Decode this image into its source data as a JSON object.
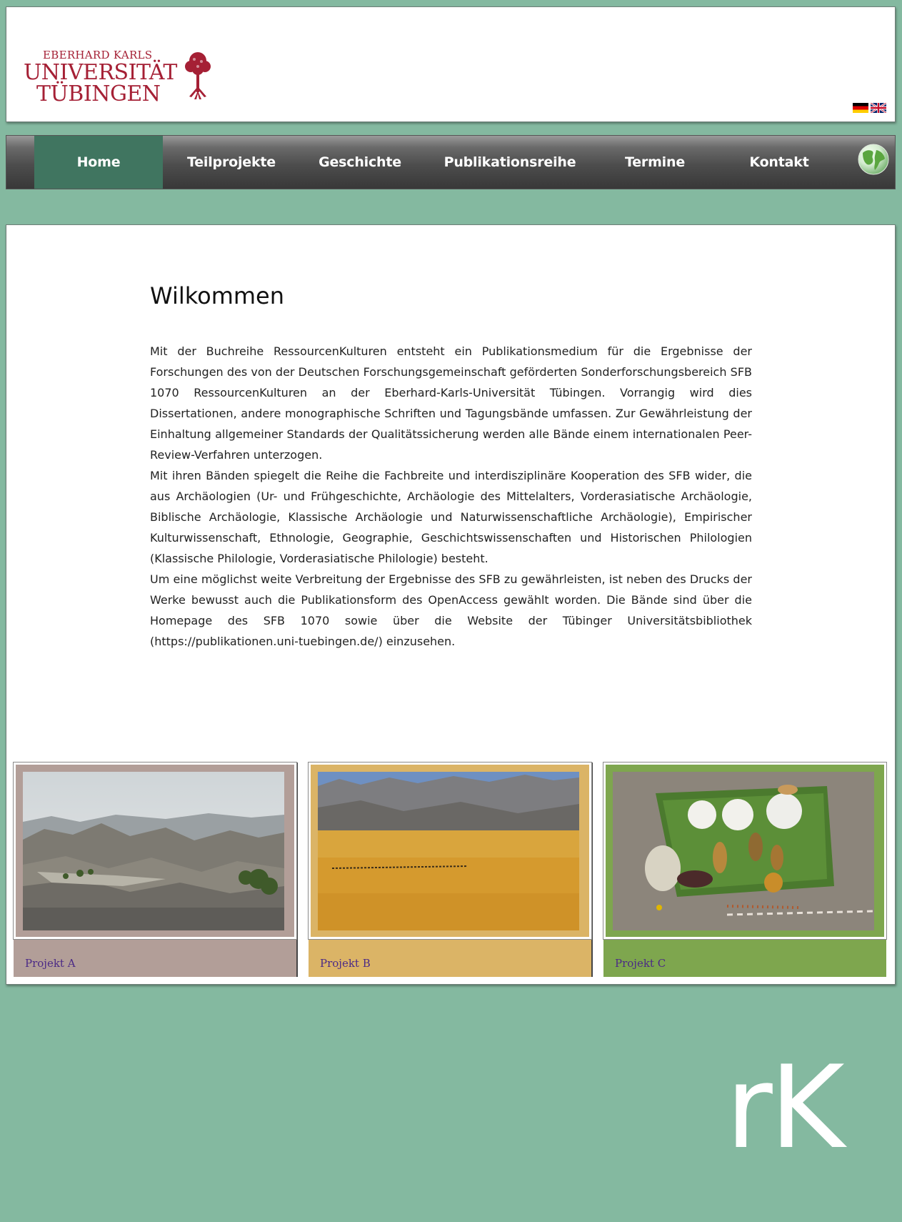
{
  "header": {
    "logo": {
      "line1": "EBERHARD KARLS",
      "line2": "UNIVERSITÄT",
      "line3": "TÜBINGEN",
      "color": "#a52035"
    },
    "languages": [
      "de-flag-icon",
      "uk-flag-icon"
    ]
  },
  "nav": {
    "items": [
      {
        "label": "Home",
        "active": true
      },
      {
        "label": "Teilprojekte"
      },
      {
        "label": "Geschichte"
      },
      {
        "label": "Publikationsreihe"
      },
      {
        "label": "Termine"
      },
      {
        "label": "Kontakt"
      }
    ],
    "globe_icon": "globe-icon"
  },
  "main": {
    "title": "Wilkommen",
    "paragraphs": [
      "Mit der Buchreihe RessourcenKulturen entsteht ein Publikationsmedium für die Ergebnisse der Forschungen des von der Deutschen Forschungsgemeinschaft geförderten Sonderforschungsbereich SFB 1070 RessourcenKulturen an der Eberhard-Karls-Universität Tübingen. Vorrangig wird dies Dissertationen, andere monographische Schriften und Tagungsbände umfassen. Zur Gewährleistung der Einhaltung allgemeiner Standards der Qualitätssicherung werden alle Bände einem internationalen Peer-Review-Verfahren unterzogen.",
      "Mit ihren Bänden spiegelt die Reihe die Fachbreite und interdisziplinäre Kooperation des SFB wider, die aus Archäologien (Ur- und Frühgeschichte, Archäologie des Mittelalters, Vorderasiatische Archäologie, Biblische Archäologie, Klassische Archäologie und Naturwissenschaftliche Archäologie), Empirischer Kulturwissenschaft, Ethnologie, Geographie, Geschichtswissenschaften und Historischen Philologien (Klassische Philologie, Vorderasiatische Philologie) besteht.",
      "Um eine möglichst weite Verbreitung der Ergebnisse des SFB zu gewährleisten, ist neben des Drucks der Werke bewusst auch die Publikationsform des OpenAccess gewählt worden. Die Bände sind über die Homepage des SFB 1070 sowie über die Website der Tübinger Universitätsbibliothek (https://publikationen.uni-tuebingen.de/) einzusehen."
    ],
    "projects": [
      {
        "label": "Projekt A",
        "color": "#b29e98"
      },
      {
        "label": "Projekt B",
        "color": "#dbb466"
      },
      {
        "label": "Projekt C",
        "color": "#7ea64e"
      }
    ]
  },
  "footer": {
    "logo_text": "rK"
  },
  "colors": {
    "background": "#84b9a0",
    "nav_active": "#407560"
  }
}
